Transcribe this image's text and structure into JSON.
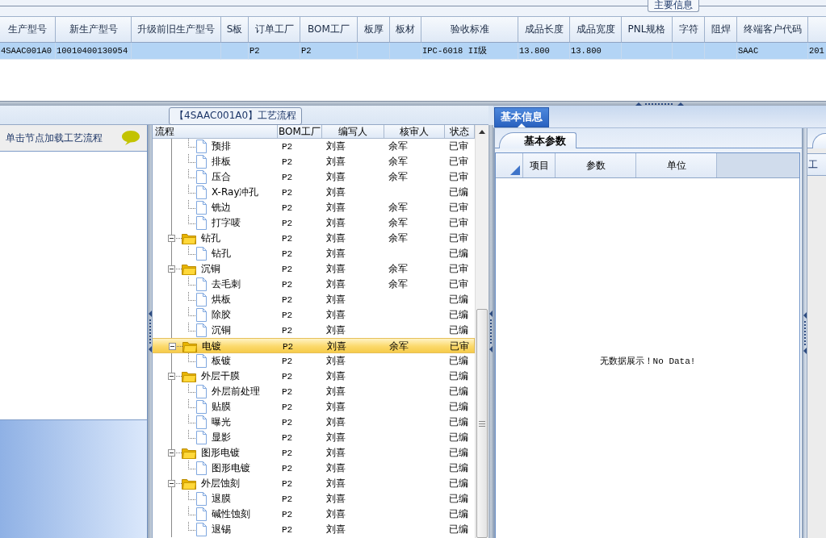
{
  "top_section": {
    "tab": {
      "label": "主要信息",
      "selected": true
    },
    "columns": [
      "生产型号",
      "新生产型号",
      "升级前旧生产型号",
      "S板",
      "订单工厂",
      "BOM工厂",
      "板厚",
      "板材",
      "验收标准",
      "成品长度",
      "成品宽度",
      "PNL规格",
      "字符",
      "阻焊",
      "终端客户代码",
      null
    ],
    "rows": [
      {
        "selected": true,
        "cells": [
          "4SAAC001A0",
          "10010400130954",
          null,
          null,
          "P2",
          "P2",
          null,
          null,
          "IPC-6018 II级",
          "13.800",
          "13.800",
          null,
          null,
          null,
          "SAAC",
          "201"
        ]
      }
    ]
  },
  "flow_group": {
    "title": "【4SAAC001A0】工艺流程"
  },
  "left_panel": {
    "hint": "单击节点加载工艺流程"
  },
  "tree": {
    "columns": [
      "流程",
      "BOM工厂",
      "编写人",
      "核审人",
      "状态"
    ],
    "items": [
      {
        "kind": "file",
        "label": "预排",
        "bom": "P2",
        "writer": "刘喜",
        "reviewer": "余军",
        "status": "已审",
        "selected": false
      },
      {
        "kind": "file",
        "label": "排板",
        "bom": "P2",
        "writer": "刘喜",
        "reviewer": "余军",
        "status": "已审",
        "selected": false
      },
      {
        "kind": "file",
        "label": "压合",
        "bom": "P2",
        "writer": "刘喜",
        "reviewer": "余军",
        "status": "已审",
        "selected": false
      },
      {
        "kind": "file",
        "label": "X-Ray冲孔",
        "bom": "P2",
        "writer": "刘喜",
        "status": "已编",
        "selected": false
      },
      {
        "kind": "file",
        "label": "铣边",
        "bom": "P2",
        "writer": "刘喜",
        "reviewer": "余军",
        "status": "已审",
        "selected": false
      },
      {
        "kind": "file",
        "label": "打字唛",
        "bom": "P2",
        "writer": "刘喜",
        "reviewer": "余军",
        "status": "已审",
        "selected": false
      },
      {
        "kind": "folder",
        "label": "钻孔",
        "bom": "P2",
        "writer": "刘喜",
        "reviewer": "余军",
        "status": "已审",
        "selected": false,
        "expanded": true,
        "children": [
          {
            "kind": "file",
            "label": "钻孔",
            "bom": "P2",
            "writer": "刘喜",
            "status": "已编",
            "selected": false
          }
        ]
      },
      {
        "kind": "folder",
        "label": "沉铜",
        "bom": "P2",
        "writer": "刘喜",
        "reviewer": "余军",
        "status": "已审",
        "selected": false,
        "expanded": true,
        "children": [
          {
            "kind": "file",
            "label": "去毛刺",
            "bom": "P2",
            "writer": "刘喜",
            "reviewer": "余军",
            "status": "已审",
            "selected": false
          },
          {
            "kind": "file",
            "label": "烘板",
            "bom": "P2",
            "writer": "刘喜",
            "status": "已编",
            "selected": false
          },
          {
            "kind": "file",
            "label": "除胶",
            "bom": "P2",
            "writer": "刘喜",
            "status": "已编",
            "selected": false
          },
          {
            "kind": "file",
            "label": "沉铜",
            "bom": "P2",
            "writer": "刘喜",
            "status": "已编",
            "selected": false
          }
        ]
      },
      {
        "kind": "folder",
        "label": "电镀",
        "bom": "P2",
        "writer": "刘喜",
        "reviewer": "余军",
        "status": "已审",
        "selected": true,
        "expanded": true,
        "children": [
          {
            "kind": "file",
            "label": "板镀",
            "bom": "P2",
            "writer": "刘喜",
            "status": "已编",
            "selected": false
          }
        ]
      },
      {
        "kind": "folder",
        "label": "外层干膜",
        "bom": "P2",
        "writer": "刘喜",
        "status": "已编",
        "selected": false,
        "expanded": true,
        "children": [
          {
            "kind": "file",
            "label": "外层前处理",
            "bom": "P2",
            "writer": "刘喜",
            "status": "已编",
            "selected": false
          },
          {
            "kind": "file",
            "label": "贴膜",
            "bom": "P2",
            "writer": "刘喜",
            "status": "已编",
            "selected": false
          },
          {
            "kind": "file",
            "label": "曝光",
            "bom": "P2",
            "writer": "刘喜",
            "status": "已编",
            "selected": false
          },
          {
            "kind": "file",
            "label": "显影",
            "bom": "P2",
            "writer": "刘喜",
            "status": "已编",
            "selected": false
          }
        ]
      },
      {
        "kind": "folder",
        "label": "图形电镀",
        "bom": "P2",
        "writer": "刘喜",
        "status": "已编",
        "selected": false,
        "expanded": true,
        "children": [
          {
            "kind": "file",
            "label": "图形电镀",
            "bom": "P2",
            "writer": "刘喜",
            "status": "已编",
            "selected": false
          }
        ]
      },
      {
        "kind": "folder",
        "label": "外层蚀刻",
        "bom": "P2",
        "writer": "刘喜",
        "status": "已编",
        "selected": false,
        "expanded": true,
        "children": [
          {
            "kind": "file",
            "label": "退膜",
            "bom": "P2",
            "writer": "刘喜",
            "status": "已编",
            "selected": false
          },
          {
            "kind": "file",
            "label": "碱性蚀刻",
            "bom": "P2",
            "writer": "刘喜",
            "status": "已编",
            "selected": false
          },
          {
            "kind": "file",
            "label": "退锡",
            "bom": "P2",
            "writer": "刘喜",
            "status": "已编",
            "selected": false
          }
        ]
      }
    ]
  },
  "info_panel": {
    "tabs": [
      {
        "label": "基本信息",
        "selected": true
      }
    ],
    "subtabs": [
      {
        "label": "基本参数",
        "selected": true
      }
    ],
    "columns": [
      "项目",
      "参数",
      "单位"
    ],
    "empty_text": "无数据展示！No Data!"
  },
  "side_panel": {
    "label": "工"
  }
}
